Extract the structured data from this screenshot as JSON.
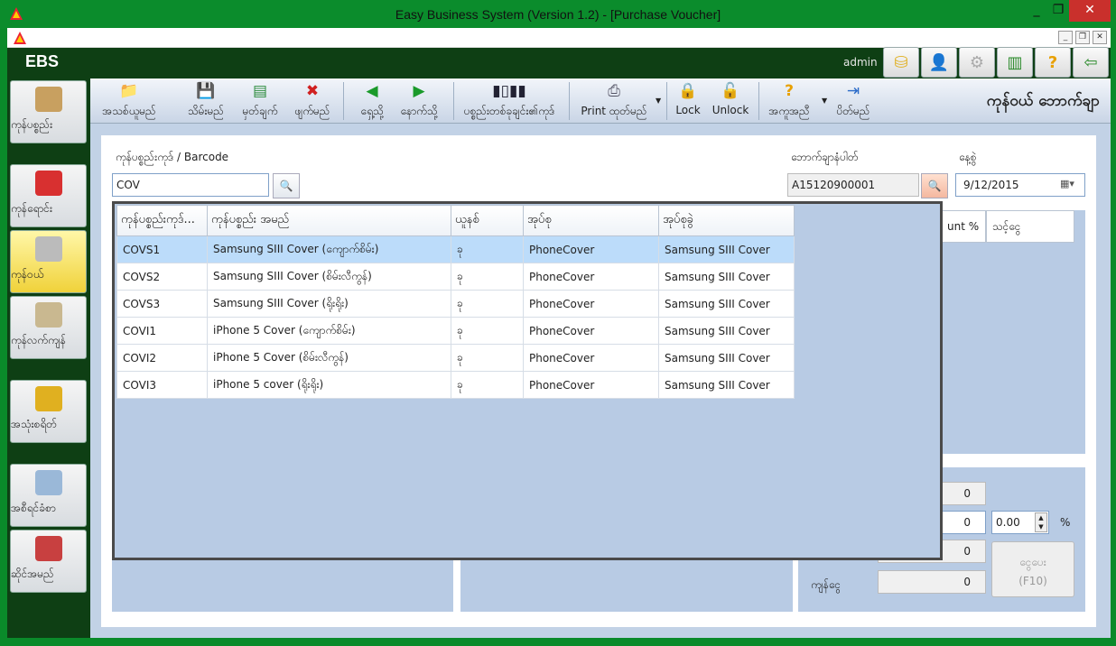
{
  "window": {
    "title": "Easy Business System  (Version 1.2) - [Purchase Voucher]"
  },
  "topbar": {
    "logo": "EBS",
    "user": "admin"
  },
  "nav": [
    {
      "label": "ကုန်ပစ္စည်း"
    },
    {
      "label": "ကုန်ရောင်း"
    },
    {
      "label": "ကုန်ဝယ်"
    },
    {
      "label": "ကုန်လက်ကျန်"
    },
    {
      "label": "အသုံးစရိတ်"
    },
    {
      "label": "အစီရင်ခံစာ"
    },
    {
      "label": "ဆိုင်အမည်"
    }
  ],
  "toolbar": {
    "new": "အသစ်ယူမည်",
    "save": "သိမ်းမည်",
    "note": "မှတ်ချက်",
    "delete": "ဖျက်မည်",
    "prev": "ရှေ့သို့",
    "next": "နောက်သို့",
    "barcode": "ပစ္စည်းတစ်ခုချင်း၏ကုဒ်",
    "print": "Print ထုတ်မည်",
    "lock": "Lock",
    "unlock": "Unlock",
    "help": "အကူအညီ",
    "close": "ပိတ်မည်",
    "page_title": "ကုန်ဝယ် ဘောက်ချာ"
  },
  "form": {
    "code_label": "ကုန်ပစ္စည်းကုဒ်  / Barcode",
    "code_value": "COV",
    "voucher_label": "ဘောက်ချာနံပါတ်",
    "voucher_value": "A15120900001",
    "date_label": "နေ့စွဲ",
    "date_value": "9/12/2015"
  },
  "right_grid": {
    "col1": "unt %",
    "col2": "သင့်ငွေ"
  },
  "dropdown": {
    "columns": [
      "ကုန်ပစ္စည်းကုဒ်...",
      "ကုန်ပစ္စည်း အမည်",
      "ယူနစ်",
      "အုပ်စု",
      "အုပ်စုခွဲ"
    ],
    "rows": [
      {
        "code": "COVS1",
        "name": "Samsung SIII Cover (ကျောက်စိမ်း)",
        "unit": "ခု",
        "group": "PhoneCover",
        "subgroup": "Samsung SIII Cover"
      },
      {
        "code": "COVS2",
        "name": "Samsung SIII Cover (စိမ်းလီကွန်)",
        "unit": "ခု",
        "group": "PhoneCover",
        "subgroup": "Samsung SIII Cover"
      },
      {
        "code": "COVS3",
        "name": "Samsung SIII Cover (ရိုးရိုး)",
        "unit": "ခု",
        "group": "PhoneCover",
        "subgroup": "Samsung SIII Cover"
      },
      {
        "code": "COVI1",
        "name": "iPhone 5 Cover (ကျောက်စိမ်း)",
        "unit": "ခု",
        "group": "PhoneCover",
        "subgroup": "Samsung SIII Cover"
      },
      {
        "code": "COVI2",
        "name": "iPhone 5 Cover (စိမ်းလီကွန်)",
        "unit": "ခု",
        "group": "PhoneCover",
        "subgroup": "Samsung SIII Cover"
      },
      {
        "code": "COVI3",
        "name": "iPhone 5 cover (ရိုးရိုး)",
        "unit": "ခု",
        "group": "PhoneCover",
        "subgroup": "Samsung SIII Cover"
      }
    ]
  },
  "totals": {
    "v1": "0",
    "v2": "0",
    "discount": "0.00",
    "pct": "%",
    "v3": "0",
    "balance_label": "ကျန်ငွေ",
    "balance": "0",
    "pay_label": "ငွေပေး",
    "pay_key": "(F10)"
  }
}
